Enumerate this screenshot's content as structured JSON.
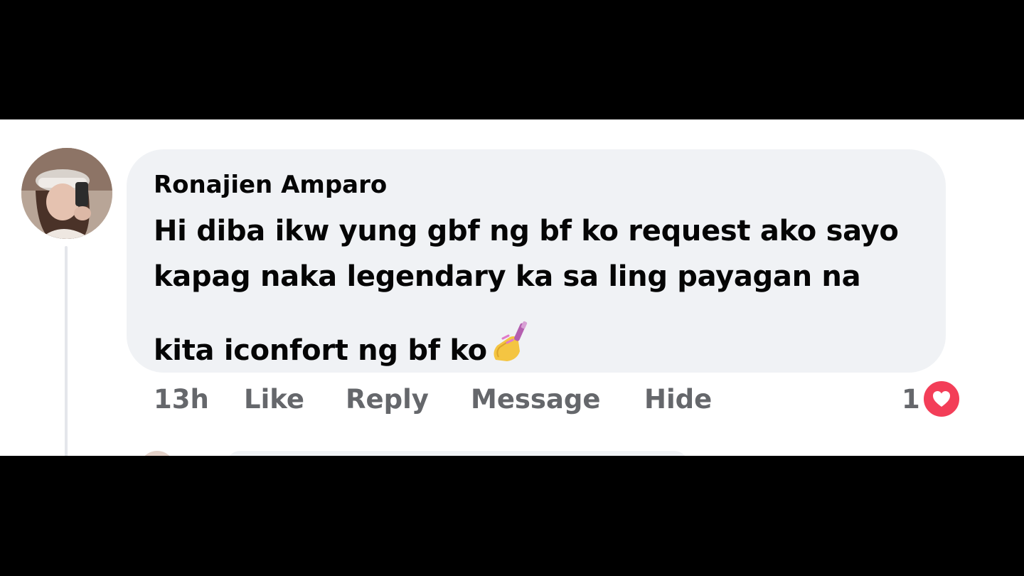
{
  "comment": {
    "author": "Ronajien Amparo",
    "lines": [
      "Hi diba ikw yung gbf ng bf ko request ako sayo",
      "kapag naka legendary ka sa ling payagan na",
      "kita iconfort ng bf ko"
    ],
    "emoji": "nail-polish-icon"
  },
  "actions": {
    "time": "13h",
    "like": "Like",
    "reply": "Reply",
    "message": "Message",
    "hide": "Hide"
  },
  "reactions": {
    "count": "1",
    "type": "heart-icon",
    "color": "#f33e58"
  },
  "colors": {
    "bubble": "#f0f2f5",
    "secondary_text": "#65676b",
    "primary_text": "#050505"
  }
}
